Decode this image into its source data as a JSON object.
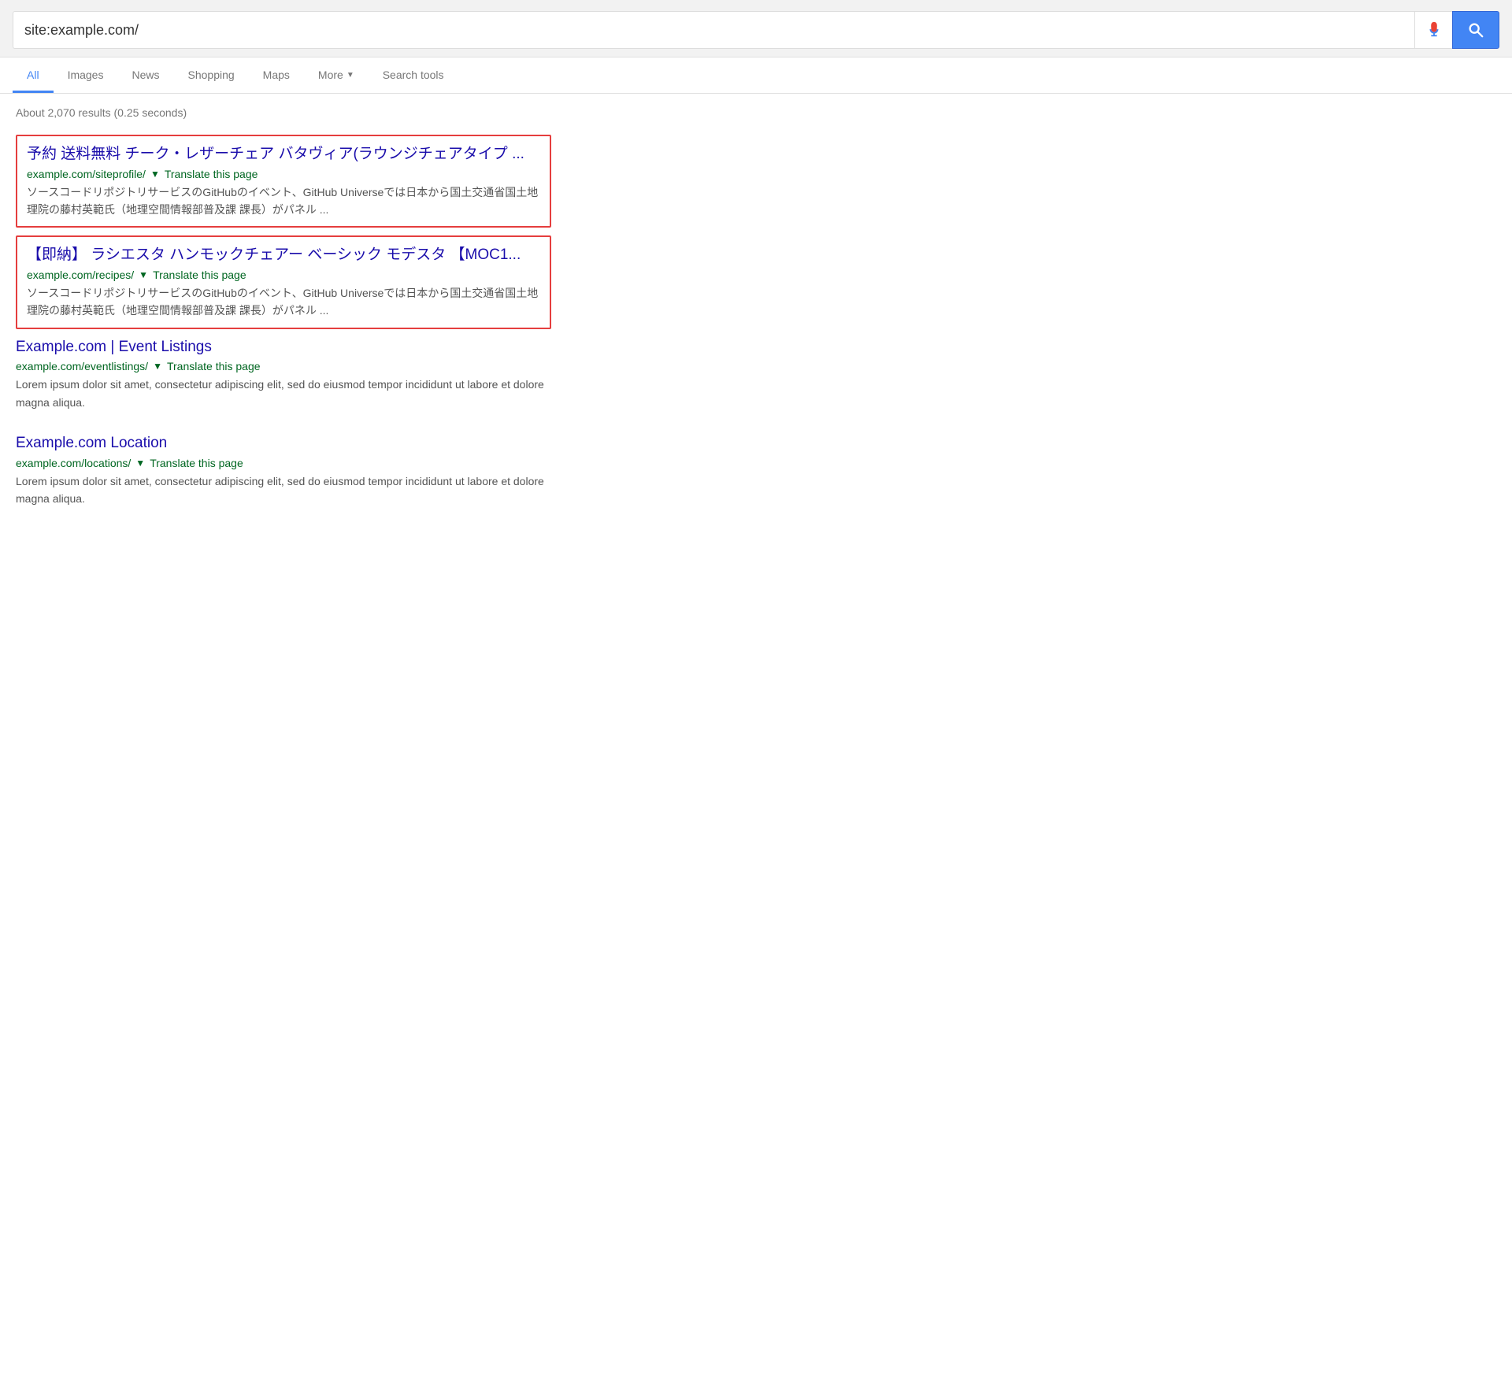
{
  "search": {
    "query": "site:example.com/",
    "mic_label": "microphone",
    "search_button_label": "search"
  },
  "nav": {
    "tabs": [
      {
        "id": "all",
        "label": "All",
        "active": true,
        "has_arrow": false
      },
      {
        "id": "images",
        "label": "Images",
        "active": false,
        "has_arrow": false
      },
      {
        "id": "news",
        "label": "News",
        "active": false,
        "has_arrow": false
      },
      {
        "id": "shopping",
        "label": "Shopping",
        "active": false,
        "has_arrow": false
      },
      {
        "id": "maps",
        "label": "Maps",
        "active": false,
        "has_arrow": false
      },
      {
        "id": "more",
        "label": "More",
        "active": false,
        "has_arrow": true
      },
      {
        "id": "search-tools",
        "label": "Search tools",
        "active": false,
        "has_arrow": false
      }
    ]
  },
  "results": {
    "stats": "About 2,070 results (0.25 seconds)",
    "items": [
      {
        "id": "result-1",
        "highlighted": true,
        "title": "予約 送料無料 チーク・レザーチェア バタヴィア(ラウンジチェアタイプ ...",
        "url": "example.com/siteprofile/",
        "translate_label": "Translate this page",
        "snippet": "ソースコードリポジトリサービスのGitHubのイベント、GitHub Universeでは日本から国土交通省国土地理院の藤村英範氏（地理空間情報部普及課 課長）がパネル ..."
      },
      {
        "id": "result-2",
        "highlighted": true,
        "title": "【即納】 ラシエスタ ハンモックチェアー ベーシック モデスタ 【MOC1...",
        "url": "example.com/recipes/",
        "translate_label": "Translate this page",
        "snippet": "ソースコードリポジトリサービスのGitHubのイベント、GitHub Universeでは日本から国土交通省国土地理院の藤村英範氏（地理空間情報部普及課 課長）がパネル ..."
      },
      {
        "id": "result-3",
        "highlighted": false,
        "title": "Example.com | Event Listings",
        "url": "example.com/eventlistings/",
        "translate_label": "Translate this page",
        "snippet": "Lorem ipsum dolor sit amet, consectetur adipiscing elit, sed do eiusmod tempor incididunt ut labore et dolore magna aliqua."
      },
      {
        "id": "result-4",
        "highlighted": false,
        "title": "Example.com Location",
        "url": "example.com/locations/",
        "translate_label": "Translate this page",
        "snippet": "Lorem ipsum dolor sit amet, consectetur adipiscing elit, sed do eiusmod tempor incididunt ut labore et dolore magna aliqua."
      }
    ]
  }
}
